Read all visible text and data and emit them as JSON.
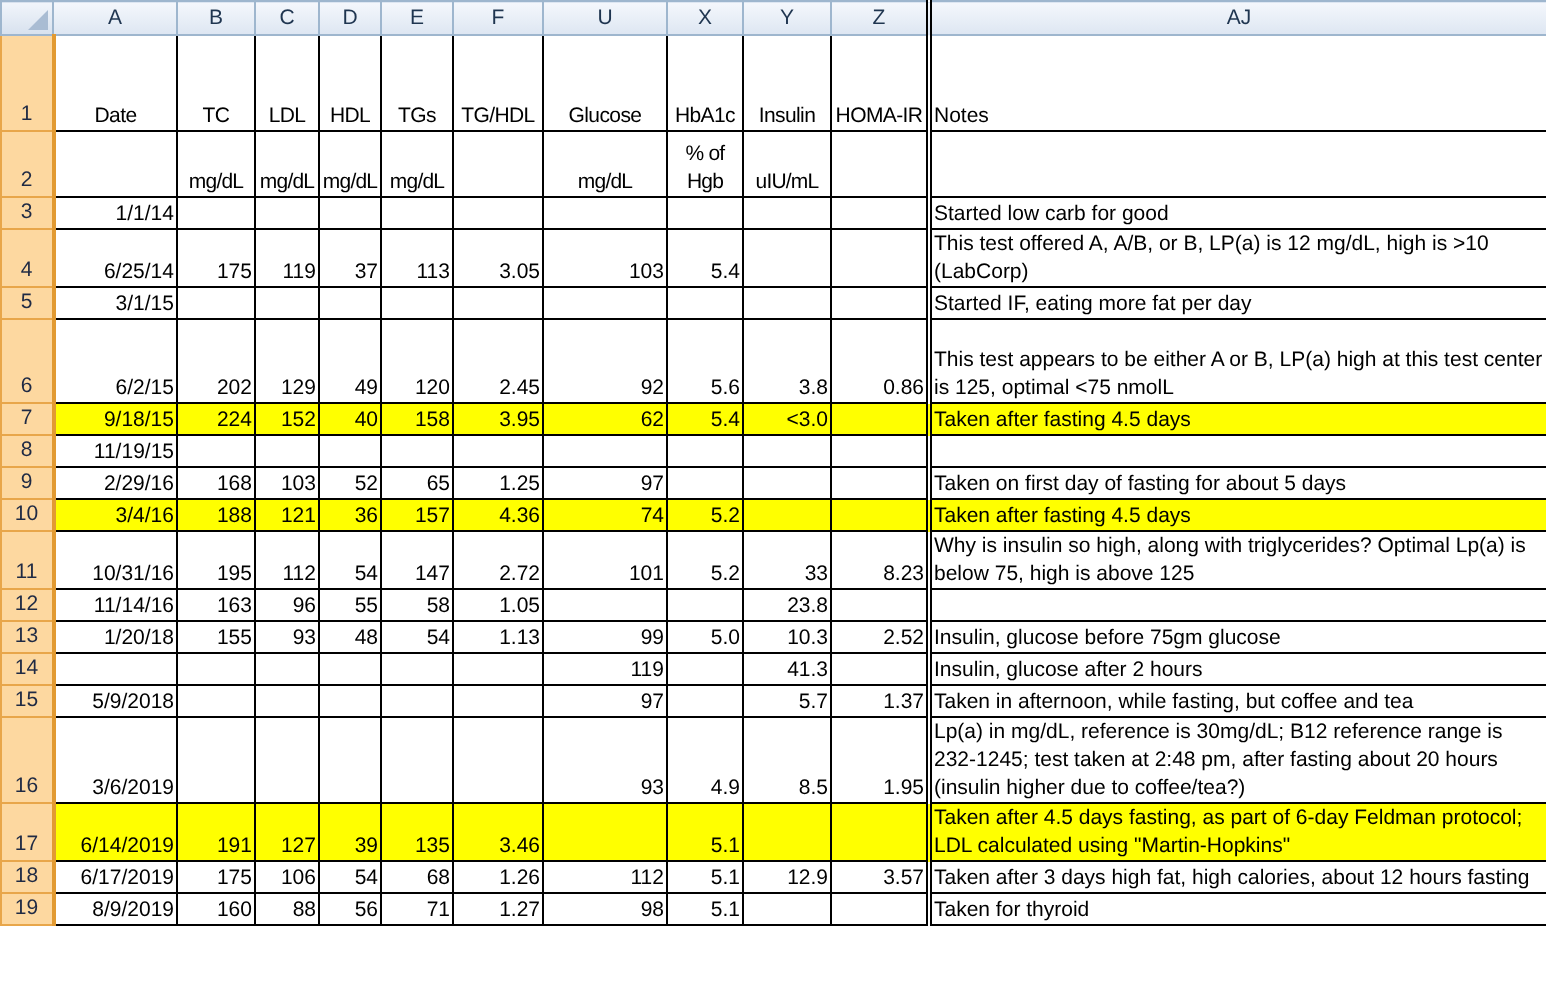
{
  "sheet": {
    "columns": [
      "A",
      "B",
      "C",
      "D",
      "E",
      "F",
      "U",
      "X",
      "Y",
      "Z",
      "AJ"
    ],
    "rows": [
      {
        "number": "1",
        "highlighted": false,
        "cells": [
          "Date",
          "TC",
          "LDL",
          "HDL",
          "TGs",
          "TG/HDL",
          "Glucose",
          "HbA1c",
          "Insulin",
          "HOMA-IR",
          "Notes"
        ]
      },
      {
        "number": "2",
        "highlighted": false,
        "cells": [
          null,
          "mg/dL",
          "mg/dL",
          "mg/dL",
          "mg/dL",
          null,
          "mg/dL",
          "% of Hgb",
          "uIU/mL",
          null,
          null
        ]
      },
      {
        "number": "3",
        "highlighted": false,
        "cells": [
          "1/1/14",
          null,
          null,
          null,
          null,
          null,
          null,
          null,
          null,
          null,
          "Started low carb for good"
        ]
      },
      {
        "number": "4",
        "highlighted": false,
        "cells": [
          "6/25/14",
          "175",
          "119",
          "37",
          "113",
          "3.05",
          "103",
          "5.4",
          null,
          null,
          "This test offered A, A/B, or B, LP(a) is 12 mg/dL, high is >10 (LabCorp)"
        ]
      },
      {
        "number": "5",
        "highlighted": false,
        "cells": [
          "3/1/15",
          null,
          null,
          null,
          null,
          null,
          null,
          null,
          null,
          null,
          "Started IF, eating more fat per day"
        ]
      },
      {
        "number": "6",
        "highlighted": false,
        "cells": [
          "6/2/15",
          "202",
          "129",
          "49",
          "120",
          "2.45",
          "92",
          "5.6",
          "3.8",
          "0.86",
          "This test appears to be either A or B, LP(a) high at this test center is 125, optimal <75 nmolL"
        ]
      },
      {
        "number": "7",
        "highlighted": true,
        "cells": [
          "9/18/15",
          "224",
          "152",
          "40",
          "158",
          "3.95",
          "62",
          "5.4",
          "<3.0",
          null,
          "Taken after fasting 4.5 days"
        ]
      },
      {
        "number": "8",
        "highlighted": false,
        "cells": [
          "11/19/15",
          null,
          null,
          null,
          null,
          null,
          null,
          null,
          null,
          null,
          null
        ]
      },
      {
        "number": "9",
        "highlighted": false,
        "cells": [
          "2/29/16",
          "168",
          "103",
          "52",
          "65",
          "1.25",
          "97",
          null,
          null,
          null,
          "Taken on first day of fasting for about 5 days"
        ]
      },
      {
        "number": "10",
        "highlighted": true,
        "cells": [
          "3/4/16",
          "188",
          "121",
          "36",
          "157",
          "4.36",
          "74",
          "5.2",
          null,
          null,
          "Taken after fasting 4.5 days"
        ]
      },
      {
        "number": "11",
        "highlighted": false,
        "cells": [
          "10/31/16",
          "195",
          "112",
          "54",
          "147",
          "2.72",
          "101",
          "5.2",
          "33",
          "8.23",
          "Why is insulin so high, along with triglycerides? Optimal Lp(a) is below 75, high is above 125"
        ]
      },
      {
        "number": "12",
        "highlighted": false,
        "cells": [
          "11/14/16",
          "163",
          "96",
          "55",
          "58",
          "1.05",
          null,
          null,
          "23.8",
          null,
          null
        ]
      },
      {
        "number": "13",
        "highlighted": false,
        "cells": [
          "1/20/18",
          "155",
          "93",
          "48",
          "54",
          "1.13",
          "99",
          "5.0",
          "10.3",
          "2.52",
          "Insulin, glucose before 75gm glucose"
        ]
      },
      {
        "number": "14",
        "highlighted": false,
        "cells": [
          null,
          null,
          null,
          null,
          null,
          null,
          "119",
          null,
          "41.3",
          null,
          "Insulin, glucose after 2 hours"
        ]
      },
      {
        "number": "15",
        "highlighted": false,
        "cells": [
          "5/9/2018",
          null,
          null,
          null,
          null,
          null,
          "97",
          null,
          "5.7",
          "1.37",
          "Taken in afternoon, while fasting, but coffee and tea"
        ]
      },
      {
        "number": "16",
        "highlighted": false,
        "cells": [
          "3/6/2019",
          null,
          null,
          null,
          null,
          null,
          "93",
          "4.9",
          "8.5",
          "1.95",
          "Lp(a) in mg/dL, reference is 30mg/dL; B12 reference range is 232-1245; test taken at 2:48 pm, after fasting about 20 hours (insulin higher due to coffee/tea?)"
        ]
      },
      {
        "number": "17",
        "highlighted": true,
        "cells": [
          "6/14/2019",
          "191",
          "127",
          "39",
          "135",
          "3.46",
          null,
          "5.1",
          null,
          null,
          "Taken after 4.5 days fasting, as part of 6-day Feldman protocol; LDL calculated using \"Martin-Hopkins\""
        ]
      },
      {
        "number": "18",
        "highlighted": false,
        "cells": [
          "6/17/2019",
          "175",
          "106",
          "54",
          "68",
          "1.26",
          "112",
          "5.1",
          "12.9",
          "3.57",
          "Taken after 3 days high fat, high calories, about 12 hours fasting"
        ]
      },
      {
        "number": "19",
        "highlighted": false,
        "cells": [
          "8/9/2019",
          "160",
          "88",
          "56",
          "71",
          "1.27",
          "98",
          "5.1",
          null,
          null,
          "Taken for thyroid"
        ]
      }
    ]
  }
}
